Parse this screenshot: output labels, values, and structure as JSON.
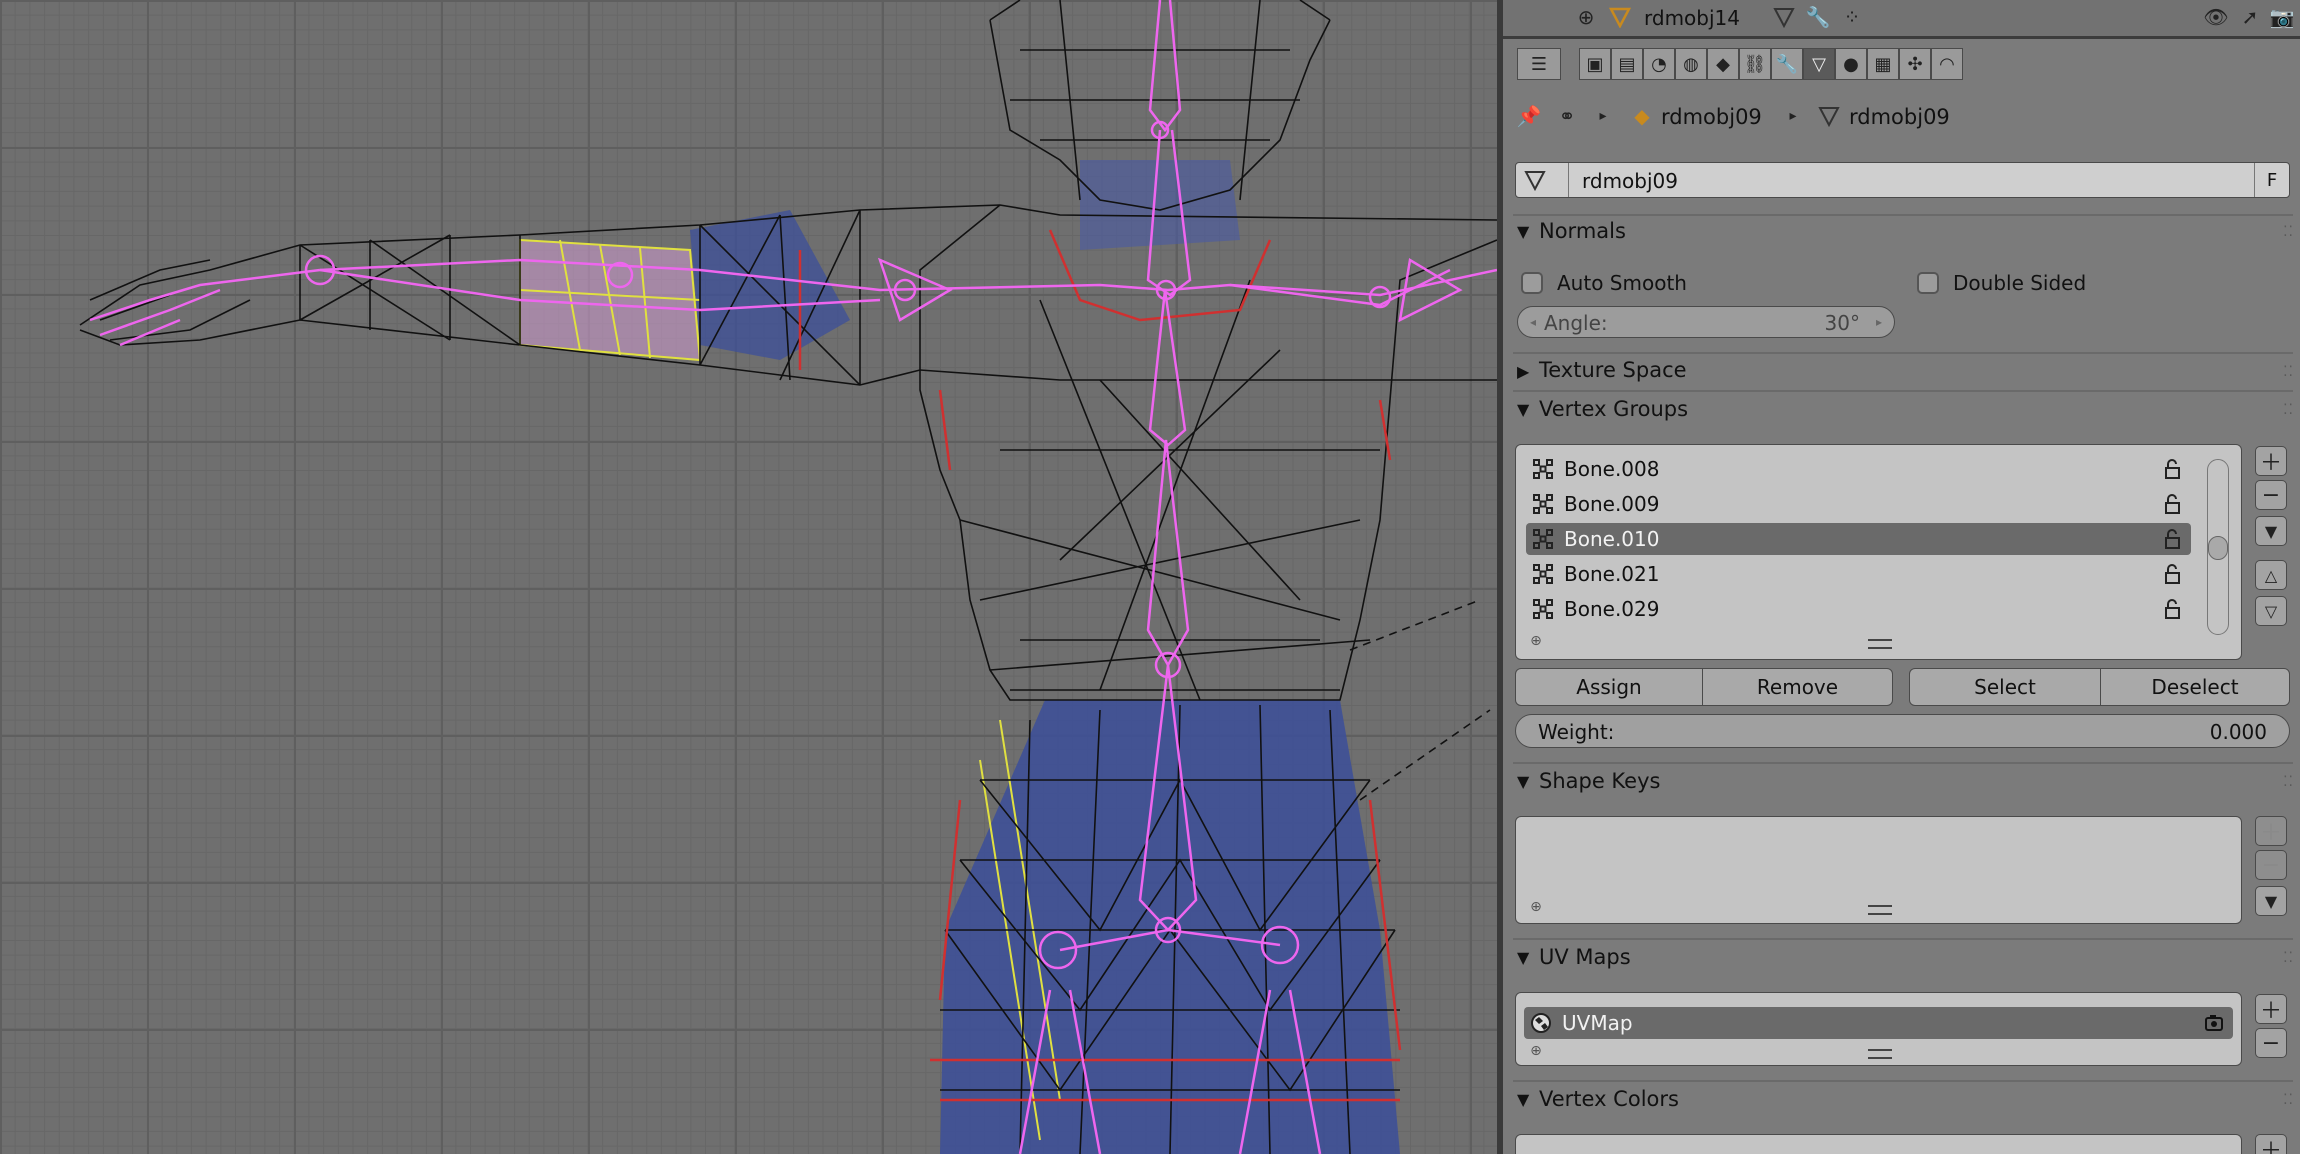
{
  "outliner": {
    "object_name": "rdmobj14"
  },
  "breadcrumb": {
    "object": "rdmobj09",
    "data": "rdmobj09"
  },
  "datablock": {
    "name": "rdmobj09",
    "fake_user": "F"
  },
  "normals": {
    "title": "Normals",
    "auto_smooth": "Auto Smooth",
    "double_sided": "Double Sided",
    "angle_label": "Angle:",
    "angle_value": "30°"
  },
  "texture_space": {
    "title": "Texture Space"
  },
  "vertex_groups": {
    "title": "Vertex Groups",
    "items": [
      "Bone.008",
      "Bone.009",
      "Bone.010",
      "Bone.021",
      "Bone.029"
    ],
    "selected_index": 2,
    "assign": "Assign",
    "remove": "Remove",
    "select": "Select",
    "deselect": "Deselect",
    "weight_label": "Weight:",
    "weight_value": "0.000"
  },
  "shape_keys": {
    "title": "Shape Keys"
  },
  "uv_maps": {
    "title": "UV Maps",
    "items": [
      "UVMap"
    ]
  },
  "vertex_colors": {
    "title": "Vertex Colors"
  },
  "icons": [
    "expand-icon",
    "mesh-data-icon",
    "eye-icon",
    "cursor-icon",
    "render-icon",
    "pin-icon",
    "object-icon",
    "plus-icon",
    "minus-icon",
    "arrow-up-icon",
    "arrow-down-icon",
    "camera-icon"
  ]
}
